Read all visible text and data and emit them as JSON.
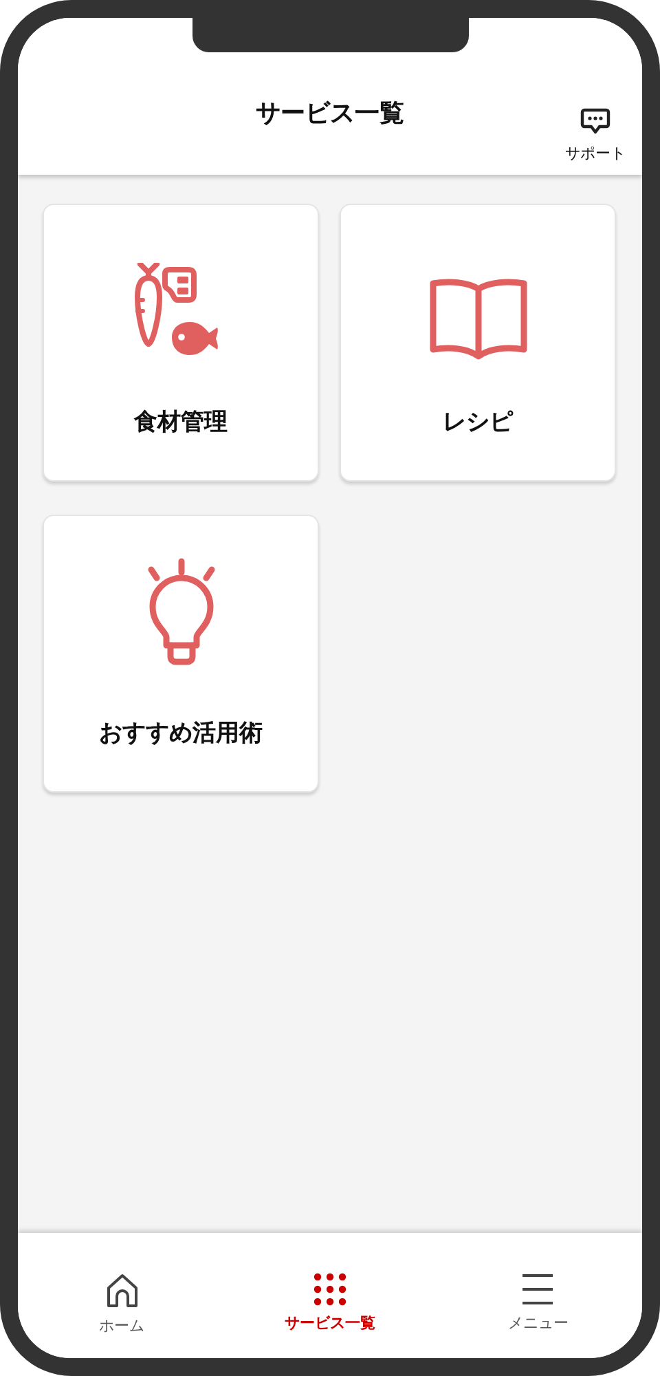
{
  "header": {
    "title": "サービス一覧",
    "support": {
      "label": "サポート"
    }
  },
  "services": [
    {
      "kind": "ingredients",
      "label": "食材管理"
    },
    {
      "kind": "recipe",
      "label": "レシピ"
    },
    {
      "kind": "tips",
      "label": "おすすめ活用術"
    }
  ],
  "nav": [
    {
      "kind": "home",
      "label": "ホーム",
      "selected": false
    },
    {
      "kind": "grid",
      "label": "サービス一覧",
      "selected": true
    },
    {
      "kind": "menu",
      "label": "メニュー",
      "selected": false
    }
  ]
}
